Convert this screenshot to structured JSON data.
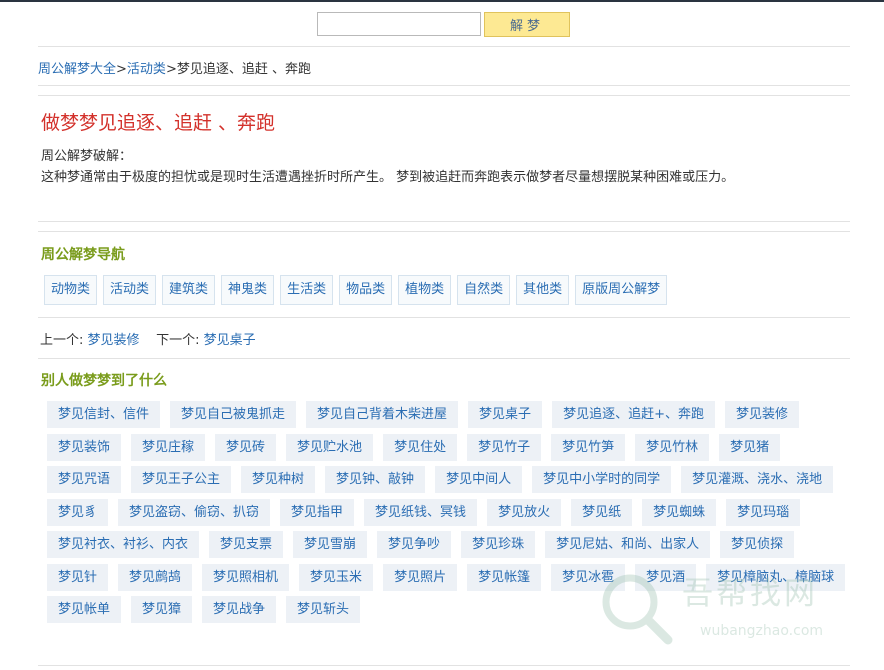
{
  "search": {
    "value": "",
    "button_label": "解梦"
  },
  "breadcrumb": {
    "items": [
      "周公解梦大全",
      "活动类"
    ],
    "current": "梦见追逐、追赶 、奔跑"
  },
  "article": {
    "title": "做梦梦见追逐、追赶 、奔跑",
    "label": "周公解梦破解：",
    "text": "这种梦通常由于极度的担忧或是现时生活遭遇挫折时所产生。 梦到被追赶而奔跑表示做梦者尽量想摆脱某种困难或压力。"
  },
  "nav": {
    "title": "周公解梦导航",
    "items": [
      "动物类",
      "活动类",
      "建筑类",
      "神鬼类",
      "生活类",
      "物品类",
      "植物类",
      "自然类",
      "其他类",
      "原版周公解梦"
    ]
  },
  "prev_next": {
    "prev_label": "上一个:",
    "prev": "梦见装修",
    "next_label": "下一个:",
    "next": "梦见桌子"
  },
  "others": {
    "title": "别人做梦梦到了什么",
    "tags": [
      "梦见信封、信件",
      "梦见自己被鬼抓走",
      "梦见自己背着木柴进屋",
      "梦见桌子",
      "梦见追逐、追赶+、奔跑",
      "梦见装修",
      "梦见装饰",
      "梦见庄稼",
      "梦见砖",
      "梦见贮水池",
      "梦见住处",
      "梦见竹子",
      "梦见竹笋",
      "梦见竹林",
      "梦见猪",
      "梦见咒语",
      "梦见王子公主",
      "梦见种树",
      "梦见钟、敲钟",
      "梦见中间人",
      "梦见中小学时的同学",
      "梦见灌溉、浇水、浇地",
      "梦见豸",
      "梦见盗窃、偷窃、扒窃",
      "梦见指甲",
      "梦见纸钱、冥钱",
      "梦见放火",
      "梦见纸",
      "梦见蜘蛛",
      "梦见玛瑙",
      "梦见衬衣、衬衫、内衣",
      "梦见支票",
      "梦见雪崩",
      "梦见争吵",
      "梦见珍珠",
      "梦见尼姑、和尚、出家人",
      "梦见侦探",
      "梦见针",
      "梦见鹧鸪",
      "梦见照相机",
      "梦见玉米",
      "梦见照片",
      "梦见帐篷",
      "梦见冰雹",
      "梦见酒",
      "梦见樟脑丸、樟脑球",
      "梦见帐单",
      "梦见獐",
      "梦见战争",
      "梦见斩头"
    ]
  },
  "watermark": {
    "name": "吾帮找网",
    "url": "wubangzhao.com"
  }
}
